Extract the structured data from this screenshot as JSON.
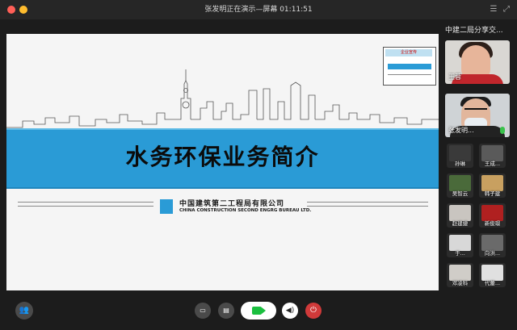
{
  "window": {
    "title": "张发明正在演示—屏幕 01:11:51"
  },
  "slide": {
    "title": "水务环保业务简介",
    "company_cn": "中国建筑第二工程局有限公司",
    "company_en": "CHINA CONSTRUCTION SECOND ENGRG BUREAU LTD.",
    "thumbnail_heading": "企业宣传"
  },
  "sidebar": {
    "meeting_title": "中建二局分享交...",
    "featured": [
      {
        "name": "王蓉"
      },
      {
        "name": "张发明..."
      }
    ],
    "participants": [
      {
        "name": "孙琳",
        "color": "#3a3a3a"
      },
      {
        "name": "王成...",
        "color": "#5a5a5a"
      },
      {
        "name": "吴智云",
        "color": "#4a6a3a"
      },
      {
        "name": "韩子建",
        "color": "#c8a060"
      },
      {
        "name": "赵建捷",
        "color": "#c9c5c0"
      },
      {
        "name": "新俊璟",
        "color": "#b02020"
      },
      {
        "name": "于...",
        "color": "#d8d8d8"
      },
      {
        "name": "向洪...",
        "color": "#6a6a6a"
      },
      {
        "name": "邓凌科",
        "color": "#d0cdc8"
      },
      {
        "name": "代蕾...",
        "color": "#e0e0e0"
      }
    ]
  },
  "colors": {
    "accent_blue": "#2a9bd6",
    "end_red": "#d03a3a",
    "video_green": "#1bbf3f"
  }
}
